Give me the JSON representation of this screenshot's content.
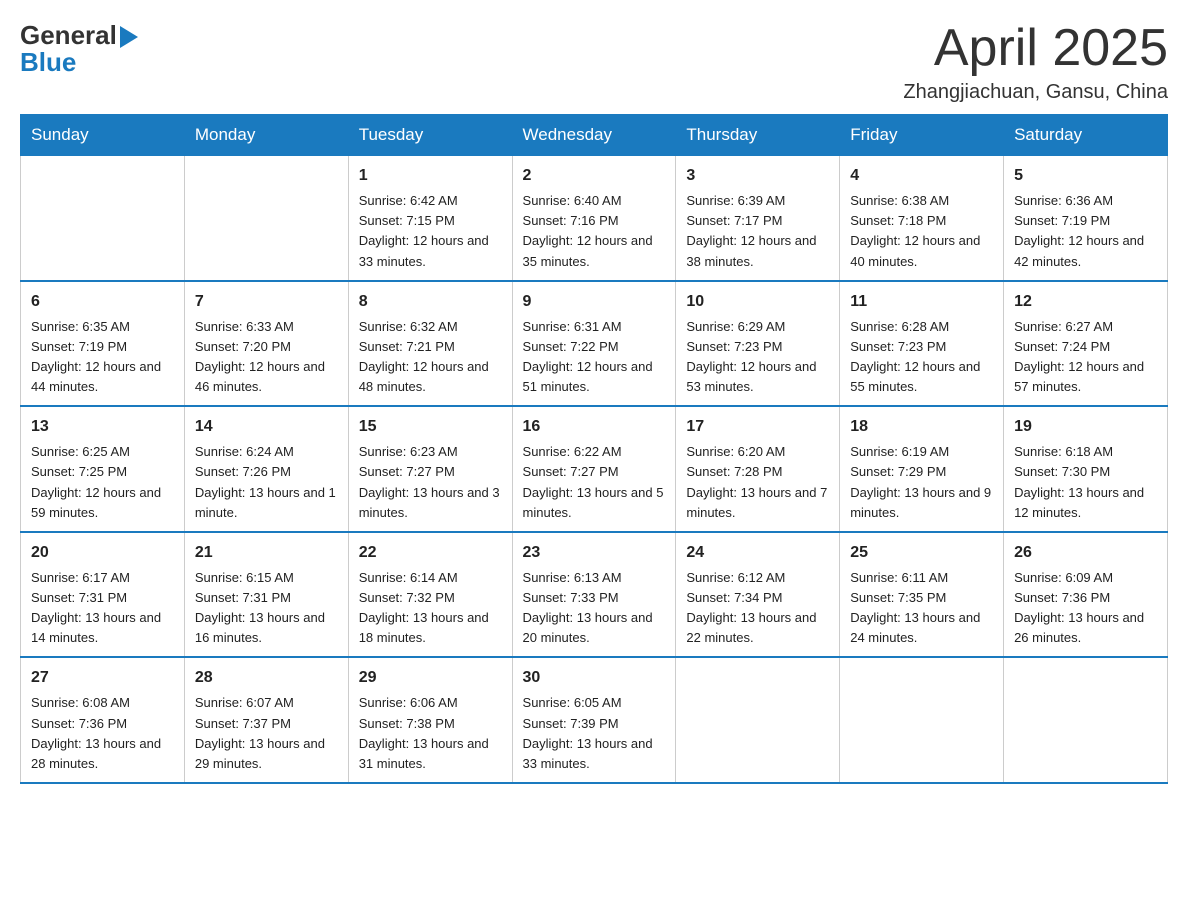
{
  "logo": {
    "line1": "General",
    "arrow": "▶",
    "line2": "Blue"
  },
  "title": "April 2025",
  "subtitle": "Zhangjiachuan, Gansu, China",
  "days_of_week": [
    "Sunday",
    "Monday",
    "Tuesday",
    "Wednesday",
    "Thursday",
    "Friday",
    "Saturday"
  ],
  "weeks": [
    [
      {
        "day": "",
        "info": ""
      },
      {
        "day": "",
        "info": ""
      },
      {
        "day": "1",
        "info": "Sunrise: 6:42 AM\nSunset: 7:15 PM\nDaylight: 12 hours\nand 33 minutes."
      },
      {
        "day": "2",
        "info": "Sunrise: 6:40 AM\nSunset: 7:16 PM\nDaylight: 12 hours\nand 35 minutes."
      },
      {
        "day": "3",
        "info": "Sunrise: 6:39 AM\nSunset: 7:17 PM\nDaylight: 12 hours\nand 38 minutes."
      },
      {
        "day": "4",
        "info": "Sunrise: 6:38 AM\nSunset: 7:18 PM\nDaylight: 12 hours\nand 40 minutes."
      },
      {
        "day": "5",
        "info": "Sunrise: 6:36 AM\nSunset: 7:19 PM\nDaylight: 12 hours\nand 42 minutes."
      }
    ],
    [
      {
        "day": "6",
        "info": "Sunrise: 6:35 AM\nSunset: 7:19 PM\nDaylight: 12 hours\nand 44 minutes."
      },
      {
        "day": "7",
        "info": "Sunrise: 6:33 AM\nSunset: 7:20 PM\nDaylight: 12 hours\nand 46 minutes."
      },
      {
        "day": "8",
        "info": "Sunrise: 6:32 AM\nSunset: 7:21 PM\nDaylight: 12 hours\nand 48 minutes."
      },
      {
        "day": "9",
        "info": "Sunrise: 6:31 AM\nSunset: 7:22 PM\nDaylight: 12 hours\nand 51 minutes."
      },
      {
        "day": "10",
        "info": "Sunrise: 6:29 AM\nSunset: 7:23 PM\nDaylight: 12 hours\nand 53 minutes."
      },
      {
        "day": "11",
        "info": "Sunrise: 6:28 AM\nSunset: 7:23 PM\nDaylight: 12 hours\nand 55 minutes."
      },
      {
        "day": "12",
        "info": "Sunrise: 6:27 AM\nSunset: 7:24 PM\nDaylight: 12 hours\nand 57 minutes."
      }
    ],
    [
      {
        "day": "13",
        "info": "Sunrise: 6:25 AM\nSunset: 7:25 PM\nDaylight: 12 hours\nand 59 minutes."
      },
      {
        "day": "14",
        "info": "Sunrise: 6:24 AM\nSunset: 7:26 PM\nDaylight: 13 hours\nand 1 minute."
      },
      {
        "day": "15",
        "info": "Sunrise: 6:23 AM\nSunset: 7:27 PM\nDaylight: 13 hours\nand 3 minutes."
      },
      {
        "day": "16",
        "info": "Sunrise: 6:22 AM\nSunset: 7:27 PM\nDaylight: 13 hours\nand 5 minutes."
      },
      {
        "day": "17",
        "info": "Sunrise: 6:20 AM\nSunset: 7:28 PM\nDaylight: 13 hours\nand 7 minutes."
      },
      {
        "day": "18",
        "info": "Sunrise: 6:19 AM\nSunset: 7:29 PM\nDaylight: 13 hours\nand 9 minutes."
      },
      {
        "day": "19",
        "info": "Sunrise: 6:18 AM\nSunset: 7:30 PM\nDaylight: 13 hours\nand 12 minutes."
      }
    ],
    [
      {
        "day": "20",
        "info": "Sunrise: 6:17 AM\nSunset: 7:31 PM\nDaylight: 13 hours\nand 14 minutes."
      },
      {
        "day": "21",
        "info": "Sunrise: 6:15 AM\nSunset: 7:31 PM\nDaylight: 13 hours\nand 16 minutes."
      },
      {
        "day": "22",
        "info": "Sunrise: 6:14 AM\nSunset: 7:32 PM\nDaylight: 13 hours\nand 18 minutes."
      },
      {
        "day": "23",
        "info": "Sunrise: 6:13 AM\nSunset: 7:33 PM\nDaylight: 13 hours\nand 20 minutes."
      },
      {
        "day": "24",
        "info": "Sunrise: 6:12 AM\nSunset: 7:34 PM\nDaylight: 13 hours\nand 22 minutes."
      },
      {
        "day": "25",
        "info": "Sunrise: 6:11 AM\nSunset: 7:35 PM\nDaylight: 13 hours\nand 24 minutes."
      },
      {
        "day": "26",
        "info": "Sunrise: 6:09 AM\nSunset: 7:36 PM\nDaylight: 13 hours\nand 26 minutes."
      }
    ],
    [
      {
        "day": "27",
        "info": "Sunrise: 6:08 AM\nSunset: 7:36 PM\nDaylight: 13 hours\nand 28 minutes."
      },
      {
        "day": "28",
        "info": "Sunrise: 6:07 AM\nSunset: 7:37 PM\nDaylight: 13 hours\nand 29 minutes."
      },
      {
        "day": "29",
        "info": "Sunrise: 6:06 AM\nSunset: 7:38 PM\nDaylight: 13 hours\nand 31 minutes."
      },
      {
        "day": "30",
        "info": "Sunrise: 6:05 AM\nSunset: 7:39 PM\nDaylight: 13 hours\nand 33 minutes."
      },
      {
        "day": "",
        "info": ""
      },
      {
        "day": "",
        "info": ""
      },
      {
        "day": "",
        "info": ""
      }
    ]
  ]
}
